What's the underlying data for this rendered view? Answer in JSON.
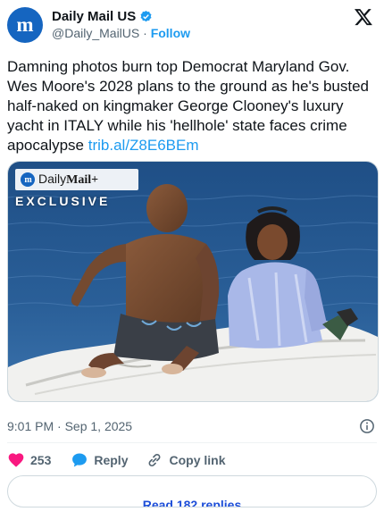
{
  "header": {
    "name": "Daily Mail US",
    "handle": "@Daily_MailUS",
    "separator": "·",
    "follow_label": "Follow",
    "avatar_text": "m"
  },
  "tweet": {
    "text": "Damning photos burn top Democrat Maryland Gov. Wes Moore's 2028 plans to the ground as he's busted half-naked on kingmaker George Clooney's luxury yacht in ITALY while his 'hellhole' state faces crime apocalypse",
    "link": "trib.al/Z8E6BEm"
  },
  "media": {
    "badge_brand_light": "Daily",
    "badge_brand_bold": "Mail+",
    "badge_m": "m",
    "badge_label": "EXCLUSIVE"
  },
  "meta": {
    "timestamp": "9:01 PM · Sep 1, 2025"
  },
  "actions": {
    "like_count": "253",
    "reply_label": "Reply",
    "copy_label": "Copy link"
  },
  "footer": {
    "read_replies_label": "Read 182 replies"
  },
  "colors": {
    "accent": "#1d9bf0",
    "like": "#f91880",
    "brand": "#1565c0"
  }
}
